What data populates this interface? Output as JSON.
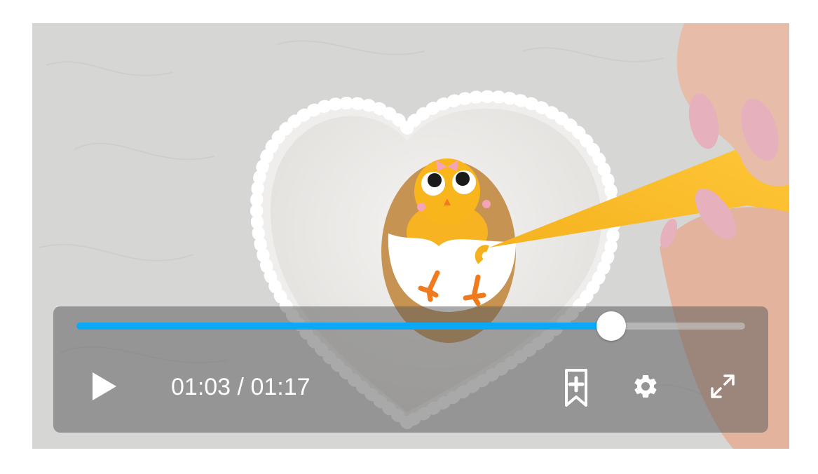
{
  "player": {
    "current_time": "01:03",
    "separator": " / ",
    "duration": "01:17",
    "progress": 0.8,
    "accent_color": "#0aa8f5"
  },
  "controls": {
    "play_icon": "play-icon",
    "bookmark_icon": "bookmark-add-icon",
    "settings_icon": "gear-icon",
    "fullscreen_icon": "fullscreen-expand-icon"
  }
}
